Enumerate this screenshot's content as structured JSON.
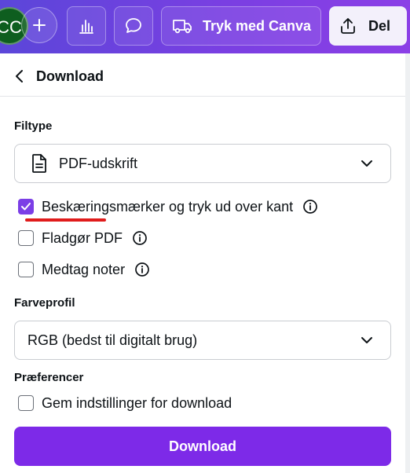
{
  "topbar": {
    "avatar_initials": "CC",
    "print_label": "Tryk med Canva",
    "share_label": "Del",
    "add_icon": "plus-icon",
    "insights_icon": "bar-chart-icon",
    "comment_icon": "comment-icon",
    "print_icon": "truck-icon",
    "share_icon": "upload-icon"
  },
  "panel": {
    "title": "Download",
    "file_type": {
      "label": "Filtype",
      "selected": "PDF-udskrift"
    },
    "options": [
      {
        "label": "Beskæringsmærker og tryk ud over kant",
        "checked": true
      },
      {
        "label": "Fladgør PDF",
        "checked": false
      },
      {
        "label": "Medtag noter",
        "checked": false
      }
    ],
    "color_profile": {
      "label": "Farveprofil",
      "selected": "RGB (bedst til digitalt brug)"
    },
    "preferences": {
      "label": "Præferencer",
      "save_settings": {
        "label": "Gem indstillinger for download",
        "checked": false
      }
    },
    "download_button": "Download"
  },
  "colors": {
    "accent": "#7d2ae8",
    "checkbox_checked": "#7b3ee6",
    "annotation_underline": "#e01c1c",
    "topbar_gradient_start": "#5b46d9",
    "topbar_gradient_end": "#8b3fe6"
  }
}
